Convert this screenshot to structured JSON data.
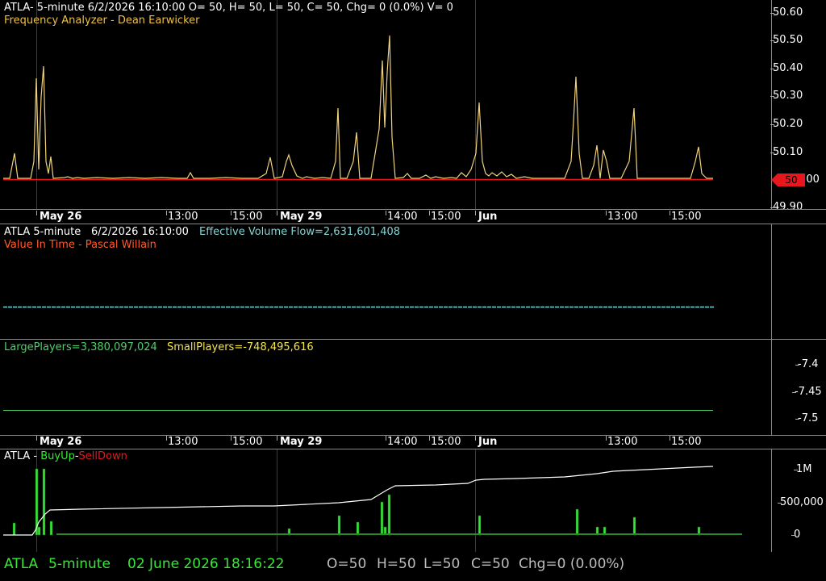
{
  "price_panel": {
    "header_line": "ATLA- 5-minute 6/2/2026 16:10:00 O= 50, H= 50, L= 50, C= 50, Chg= 0 (0.0%) V= 0",
    "indicator_line": "Frequency Analyzer - Dean Earwicker",
    "y_ticks": [
      "50.60",
      "50.50",
      "50.40",
      "50.30",
      "50.20",
      "50.10",
      "0.00",
      "49.90"
    ],
    "last_value_badge": "50",
    "colors": {
      "line": "#f0d27a",
      "baseline": "#e8161d"
    }
  },
  "x_axis": {
    "labels": [
      "May 26",
      "13:00",
      "15:00",
      "May 29",
      "14:00",
      "15:00",
      "Jun",
      "13:00",
      "15:00"
    ]
  },
  "volume_flow_panel": {
    "symbol": "ATLA 5-minute",
    "datetime": "6/2/2026 16:10:00",
    "effective_volume_flow": "Effective Volume Flow=2,631,601,408",
    "indicator_line": "Value In Time - Pascal Willain",
    "colors": {
      "line": "#7fd6d6",
      "indicator": "#ff5a2a"
    }
  },
  "players_panel": {
    "large_players": "LargePlayers=3,380,097,024",
    "small_players": "SmallPlayers=-748,495,616",
    "y_ticks": [
      "-7.4",
      "-7.45",
      "-7.5"
    ],
    "colors": {
      "large": "#4fcf6a",
      "small": "#f5e44a"
    }
  },
  "volume_panel": {
    "title_prefix": "ATLA - ",
    "buy_label": "BuyUp",
    "separator": "-",
    "sell_label": "SellDown",
    "y_ticks": [
      "1M",
      "500,000",
      "0"
    ],
    "colors": {
      "buy": "#39e639",
      "sell": "#e8161d",
      "cumulative": "#ffffff"
    }
  },
  "status_bar": {
    "symbol": "ATLA",
    "interval": "5-minute",
    "datetime": "02 June 2026 18:16:22",
    "open": "O=50",
    "high": "H=50",
    "low": "L=50",
    "close": "C=50",
    "change": "Chg=0 (0.00%)",
    "colors": {
      "left": "#39e639",
      "right": "#bdbdbd"
    }
  }
}
